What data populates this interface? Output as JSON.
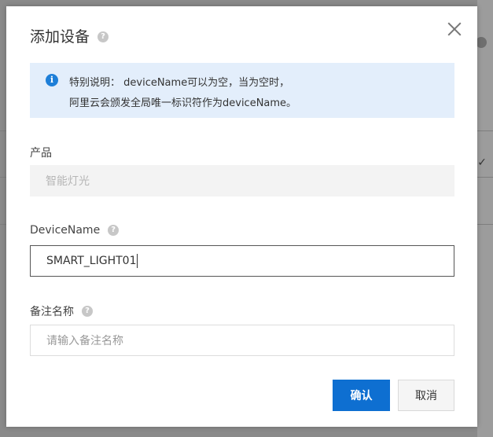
{
  "dialog": {
    "title": "添加设备",
    "help_icon": "?",
    "close_icon": "close-icon"
  },
  "notice": {
    "icon": "i",
    "line1": "特别说明： deviceName可以为空，当为空时，",
    "line2": "阿里云会颁发全局唯一标识符作为deviceName。"
  },
  "product": {
    "label": "产品",
    "value": "智能灯光"
  },
  "device_name": {
    "label": "DeviceName",
    "help_icon": "?",
    "value": "SMART_LIGHT01"
  },
  "remark": {
    "label": "备注名称",
    "help_icon": "?",
    "placeholder": "请输入备注名称"
  },
  "buttons": {
    "confirm": "确认",
    "cancel": "取消"
  },
  "colors": {
    "primary": "#0e6fd1",
    "notice_bg": "#e3eefb",
    "info_icon": "#1e7fd8"
  }
}
